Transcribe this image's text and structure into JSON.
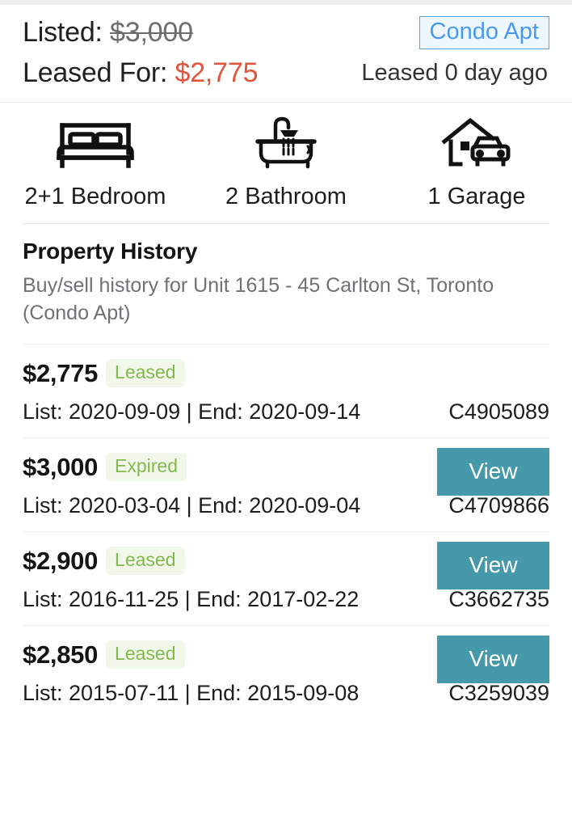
{
  "header": {
    "listed_label": "Listed:",
    "listed_price": "$3,000",
    "leased_label": "Leased For:",
    "leased_price": "$2,775",
    "property_type_badge": "Condo Apt",
    "leased_ago": "Leased 0 day ago",
    "accent_price_color": "#e0553b",
    "badge_text_color": "#4a9bf0",
    "badge_border_color": "#5ba4ec"
  },
  "features": [
    {
      "icon": "bed-icon",
      "label": "2+1 Bedroom"
    },
    {
      "icon": "bathtub-icon",
      "label": "2 Bathroom"
    },
    {
      "icon": "garage-icon",
      "label": "1 Garage"
    }
  ],
  "history": {
    "title": "Property History",
    "subtitle": "Buy/sell history for Unit 1615 - 45 Carlton St, Toronto (Condo Apt)",
    "view_label": "View",
    "view_button_color": "#4698ab",
    "status_bg_color": "#f1f7e9",
    "status_text_color": "#82ba4e",
    "rows": [
      {
        "price": "$2,775",
        "status": "Leased",
        "dates": "List: 2020-09-09 | End: 2020-09-14",
        "mls": "C4905089",
        "has_view": false
      },
      {
        "price": "$3,000",
        "status": "Expired",
        "dates": "List: 2020-03-04 | End: 2020-09-04",
        "mls": "C4709866",
        "has_view": true
      },
      {
        "price": "$2,900",
        "status": "Leased",
        "dates": "List: 2016-11-25 | End: 2017-02-22",
        "mls": "C3662735",
        "has_view": true
      },
      {
        "price": "$2,850",
        "status": "Leased",
        "dates": "List: 2015-07-11 | End: 2015-09-08",
        "mls": "C3259039",
        "has_view": true
      }
    ]
  }
}
